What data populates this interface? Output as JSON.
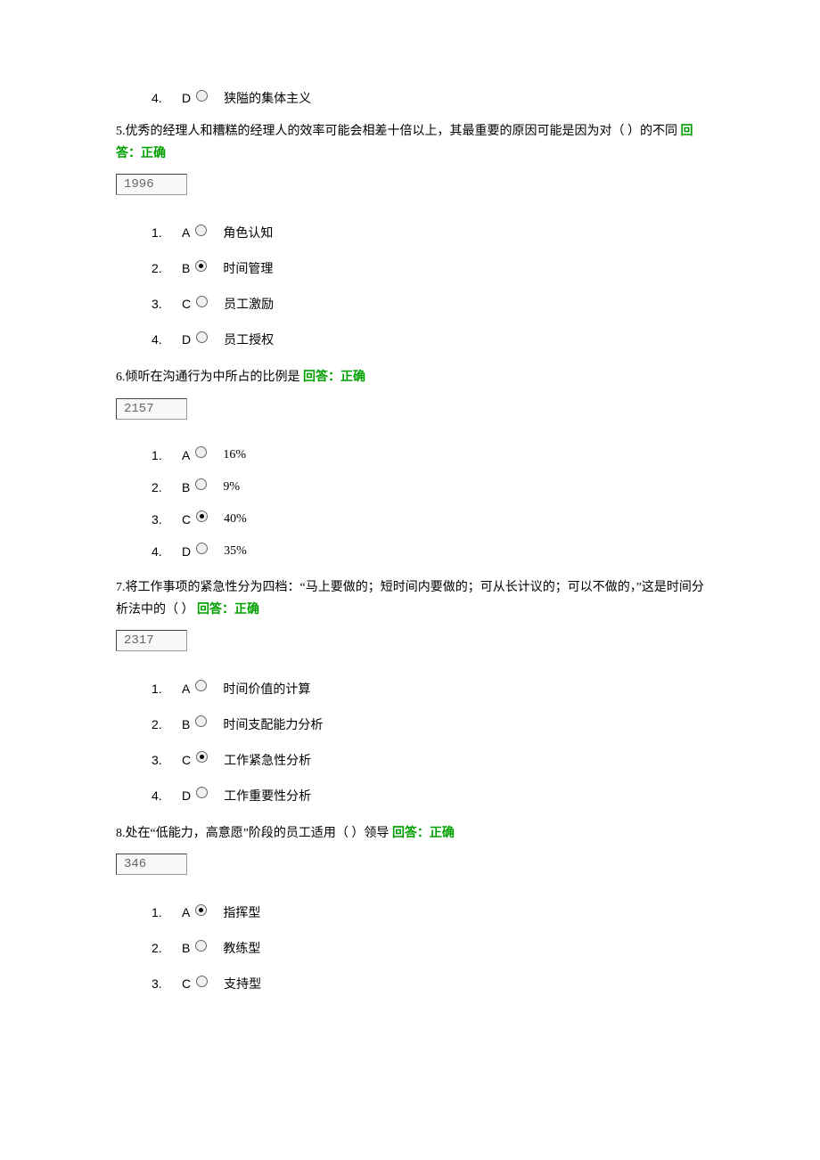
{
  "orphan_option": {
    "number": "4.",
    "letter": "D",
    "selected": false,
    "text": "狭隘的集体主义"
  },
  "questions": [
    {
      "number": "5.",
      "text": "优秀的经理人和糟糕的经理人的效率可能会相差十倍以上，其最重要的原因可能是因为对（  ）的不同",
      "feedback_label": "回答：",
      "feedback_value": "正确",
      "id_box": "1996",
      "options": [
        {
          "number": "1.",
          "letter": "A",
          "selected": false,
          "text": "角色认知"
        },
        {
          "number": "2.",
          "letter": "B",
          "selected": true,
          "text": "时间管理"
        },
        {
          "number": "3.",
          "letter": "C",
          "selected": false,
          "text": "员工激励"
        },
        {
          "number": "4.",
          "letter": "D",
          "selected": false,
          "text": "员工授权"
        }
      ]
    },
    {
      "number": "6.",
      "text": "倾听在沟通行为中所占的比例是",
      "feedback_label": "回答：",
      "feedback_value": "正确",
      "id_box": "2157",
      "options": [
        {
          "number": "1.",
          "letter": "A",
          "selected": false,
          "text": "16%"
        },
        {
          "number": "2.",
          "letter": "B",
          "selected": false,
          "text": "9%"
        },
        {
          "number": "3.",
          "letter": "C",
          "selected": true,
          "text": "40%"
        },
        {
          "number": "4.",
          "letter": "D",
          "selected": false,
          "text": "35%"
        }
      ]
    },
    {
      "number": "7.",
      "text": "将工作事项的紧急性分为四档：“马上要做的；短时间内要做的；可从长计议的；可以不做的，”这是时间分析法中的（  ）",
      "feedback_label": "回答：",
      "feedback_value": "正确",
      "id_box": "2317",
      "options": [
        {
          "number": "1.",
          "letter": "A",
          "selected": false,
          "text": "时间价值的计算"
        },
        {
          "number": "2.",
          "letter": "B",
          "selected": false,
          "text": "时间支配能力分析"
        },
        {
          "number": "3.",
          "letter": "C",
          "selected": true,
          "text": "工作紧急性分析"
        },
        {
          "number": "4.",
          "letter": "D",
          "selected": false,
          "text": "工作重要性分析"
        }
      ]
    },
    {
      "number": "8.",
      "text": "处在“低能力，高意愿”阶段的员工适用（  ）领导",
      "feedback_label": "回答：",
      "feedback_value": "正确",
      "id_box": "346",
      "options": [
        {
          "number": "1.",
          "letter": "A",
          "selected": true,
          "text": "指挥型"
        },
        {
          "number": "2.",
          "letter": "B",
          "selected": false,
          "text": "教练型"
        },
        {
          "number": "3.",
          "letter": "C",
          "selected": false,
          "text": "支持型"
        }
      ]
    }
  ]
}
